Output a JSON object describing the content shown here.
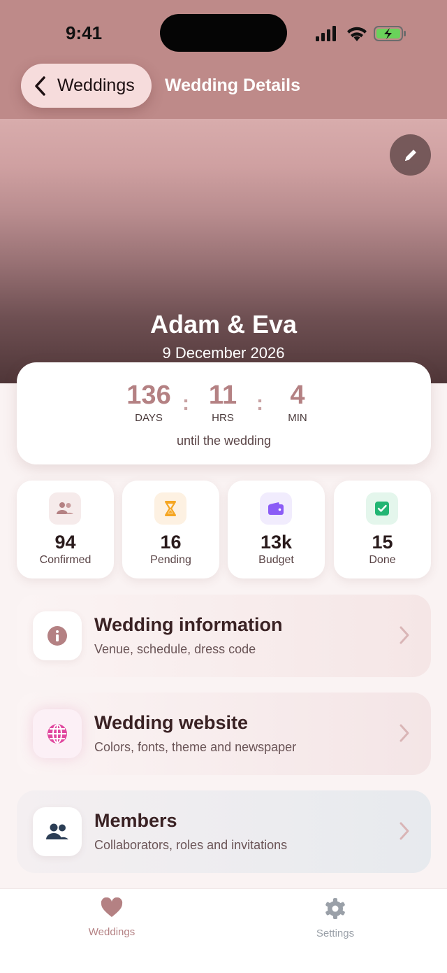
{
  "status_bar": {
    "time": "9:41"
  },
  "nav": {
    "back_label": "Weddings",
    "title": "Wedding Details"
  },
  "hero": {
    "couple": "Adam & Eva",
    "date": "9 December 2026"
  },
  "countdown": {
    "days": "136",
    "days_label": "DAYS",
    "hours": "11",
    "hours_label": "HRS",
    "minutes": "4",
    "minutes_label": "MIN",
    "separator": ":",
    "subtitle": "until the wedding"
  },
  "stats": [
    {
      "value": "94",
      "label": "Confirmed",
      "icon": "people-icon",
      "color": "#b48183"
    },
    {
      "value": "16",
      "label": "Pending",
      "icon": "hourglass-icon",
      "color": "#f5a623"
    },
    {
      "value": "13k",
      "label": "Budget",
      "icon": "wallet-icon",
      "color": "#8b5cf6"
    },
    {
      "value": "15",
      "label": "Done",
      "icon": "checkbox-icon",
      "color": "#22b573"
    }
  ],
  "cards": [
    {
      "title": "Wedding information",
      "subtitle": "Venue, schedule, dress code",
      "icon": "info-icon"
    },
    {
      "title": "Wedding website",
      "subtitle": "Colors, fonts, theme and newspaper",
      "icon": "globe-icon"
    },
    {
      "title": "Members",
      "subtitle": "Collaborators, roles and invitations",
      "icon": "members-icon"
    }
  ],
  "tabs": [
    {
      "label": "Weddings",
      "icon": "heart-icon",
      "active": true
    },
    {
      "label": "Settings",
      "icon": "gear-icon",
      "active": false
    }
  ],
  "colors": {
    "accent": "#b48183",
    "header": "#be8a89",
    "inactive": "#9aa0a8"
  }
}
